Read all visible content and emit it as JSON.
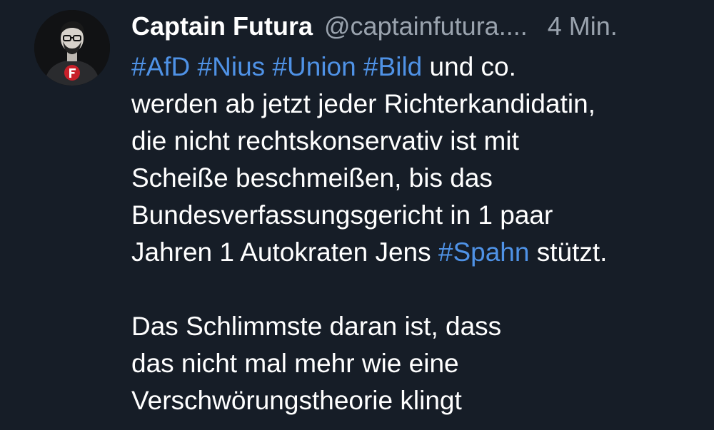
{
  "post": {
    "author": {
      "display_name": "Captain Futura",
      "handle": "@captainfutura...."
    },
    "timestamp": "4 Min.",
    "hashtags": {
      "afd": "#AfD",
      "nius": "#Nius",
      "union": "#Union",
      "bild": "#Bild",
      "spahn": "#Spahn"
    },
    "text": {
      "line1_tail": " und co.",
      "line2": "werden ab jetzt jeder Richterkandidatin,",
      "line3": "die nicht rechtskonservativ ist mit",
      "line4": "Scheiße beschmeißen, bis das",
      "line5": "Bundesverfassungsgericht in 1 paar",
      "line6_head": "Jahren 1 Autokraten Jens ",
      "line6_tail": " stützt.",
      "line7": "Das Schlimmste daran ist, dass",
      "line8": "das nicht mal mehr wie eine",
      "line9": "Verschwörungstheorie klingt"
    },
    "colors": {
      "background": "#161d27",
      "hashtag": "#4f92e6",
      "muted": "#9aa3ae",
      "avatar_accent": "#c8202a"
    },
    "avatar_icon": "avatar-man-with-red-f-emblem"
  }
}
